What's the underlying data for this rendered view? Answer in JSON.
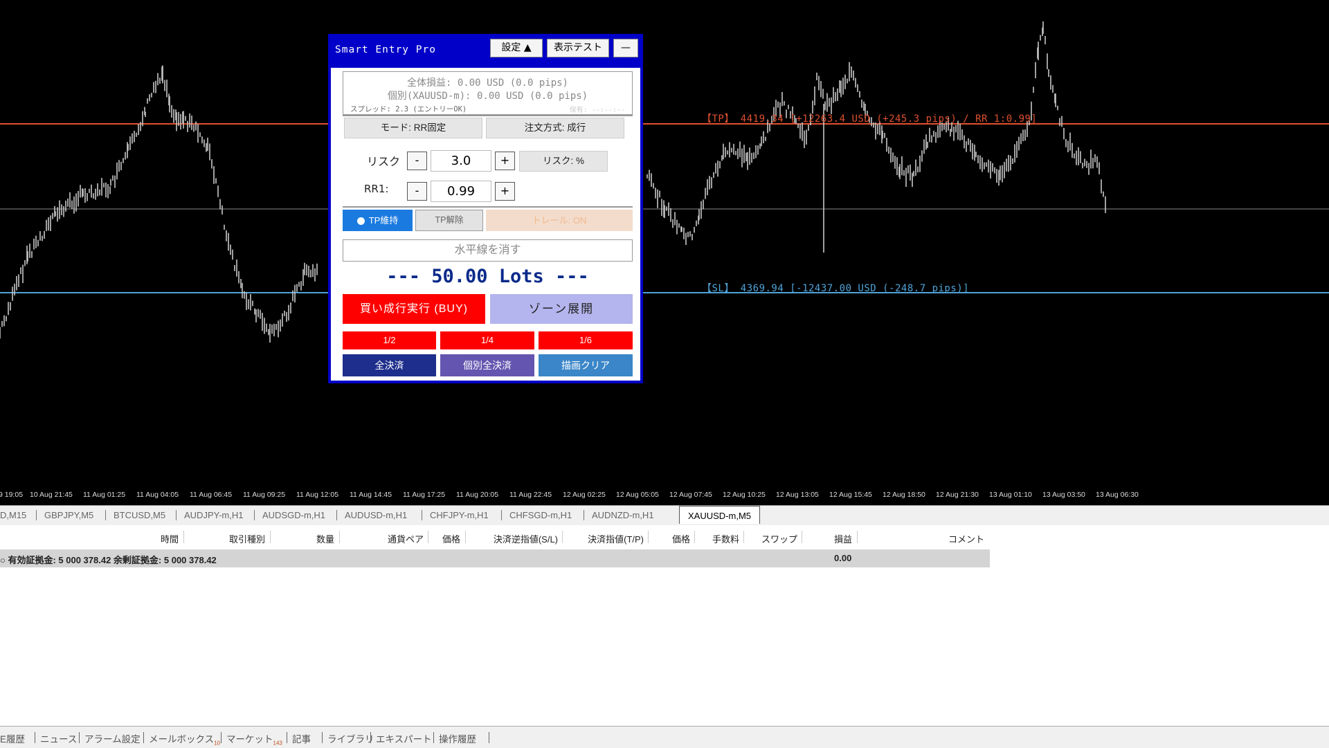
{
  "panel": {
    "title": "Smart Entry Pro",
    "settings_label": "設定 ▲",
    "display_test_label": "表示テスト",
    "minimize_label": "—",
    "info": {
      "total_pl": "全体損益: 0.00 USD (0.0 pips)",
      "individual_pl": "個別(XAUUSD-m): 0.00 USD (0.0 pips)",
      "spread": "スプレッド: 2.3 (エントリーOK)",
      "hold": "保有: --:--:--"
    },
    "mode_label": "モード: RR固定",
    "order_type_label": "注文方式: 成行",
    "risk_label": "リスク",
    "risk_value": "3.0",
    "risk_unit_label": "リスク: %",
    "rr_label": "RR1:",
    "rr_value": "0.99",
    "minus": "-",
    "plus": "+",
    "tp_keep_label": "TP維持",
    "tp_release_label": "TP解除",
    "trail_label": "トレール: ON",
    "clear_hline_label": "水平線を消す",
    "lots_text": "--- 50.00 Lots ---",
    "buy_label": "買い成行実行 (BUY)",
    "zone_label": "ゾーン展開",
    "partial": [
      "1/2",
      "1/4",
      "1/6"
    ],
    "close_all_label": "全決済",
    "close_individual_label": "個別全決済",
    "clear_draw_label": "描画クリア"
  },
  "chart": {
    "tp_label": "【TP】 4419.34 [+12263.4 USD (+245.3 pips) / RR 1:0.99]",
    "sl_label": "【SL】 4369.94 [-12437.00 USD (-248.7 pips)]",
    "time_ticks": [
      "9 19:05",
      "10 Aug 21:45",
      "11 Aug 01:25",
      "11 Aug 04:05",
      "11 Aug 06:45",
      "11 Aug 09:25",
      "11 Aug 12:05",
      "11 Aug 14:45",
      "11 Aug 17:25",
      "11 Aug 20:05",
      "11 Aug 22:45",
      "12 Aug 02:25",
      "12 Aug 05:05",
      "12 Aug 07:45",
      "12 Aug 10:25",
      "12 Aug 13:05",
      "12 Aug 15:45",
      "12 Aug 18:50",
      "12 Aug 21:30",
      "13 Aug 01:10",
      "13 Aug 03:50",
      "13 Aug 06:30"
    ],
    "colors": {
      "tp": "#e0502f",
      "sl": "#4fa3d9",
      "candles": "#c8c8c8"
    }
  },
  "symbol_tabs": [
    "D,M15",
    "GBPJPY,M5",
    "BTCUSD,M5",
    "AUDJPY-m,H1",
    "AUDSGD-m,H1",
    "AUDUSD-m,H1",
    "CHFJPY-m,H1",
    "CHFSGD-m,H1",
    "AUDNZD-m,H1",
    "XAUUSD-m,M5"
  ],
  "terminal": {
    "headers": [
      "時間",
      "取引種別",
      "数量",
      "通貨ペア",
      "価格",
      "決済逆指値(S/L)",
      "決済指値(T/P)",
      "価格",
      "手数料",
      "スワップ",
      "損益",
      "コメント"
    ],
    "balance_text": "有効証拠金: 5 000 378.42  余剰証拠金: 5 000 378.42",
    "balance_profit": "0.00"
  },
  "bottom_tabs": [
    {
      "label": "E履歴",
      "badge": ""
    },
    {
      "label": "ニュース",
      "badge": ""
    },
    {
      "label": "アラーム設定",
      "badge": ""
    },
    {
      "label": "メールボックス",
      "badge": "10"
    },
    {
      "label": "マーケット",
      "badge": "143"
    },
    {
      "label": "記事",
      "badge": ""
    },
    {
      "label": "ライブラリ",
      "badge": ""
    },
    {
      "label": "エキスパート",
      "badge": ""
    },
    {
      "label": "操作履歴",
      "badge": ""
    }
  ]
}
